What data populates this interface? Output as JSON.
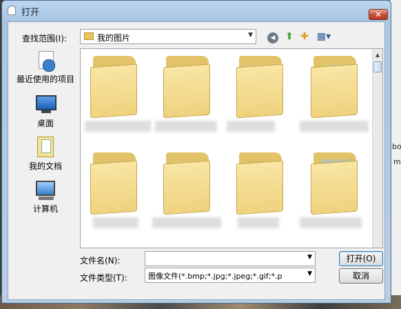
{
  "window": {
    "title": "打开",
    "close_label": "✕"
  },
  "toolbar": {
    "lookin_label": "查找范围(I):",
    "lookin_value": "我的图片",
    "combo_arrow": "▼",
    "back_glyph": "◀",
    "up_glyph": "⬆",
    "newfolder_glyph": "✚",
    "views_glyph": "▦▾"
  },
  "places": [
    {
      "label": "最近使用的项目",
      "icon": "recent-items-icon"
    },
    {
      "label": "桌面",
      "icon": "desktop-icon"
    },
    {
      "label": "我的文档",
      "icon": "my-documents-icon"
    },
    {
      "label": "计算机",
      "icon": "computer-icon"
    }
  ],
  "scroll": {
    "up_glyph": "▲"
  },
  "filename": {
    "label": "文件名(N):",
    "value": "",
    "arrow": "▼"
  },
  "filetype": {
    "label": "文件类型(T):",
    "value": "图像文件(*.bmp;*.jpg;*.jpeg;*.gif;*.p",
    "arrow": "▼"
  },
  "buttons": {
    "open": "打开(O)",
    "cancel": "取消"
  },
  "edge_text": [
    "bo",
    "m"
  ],
  "colors": {
    "title_bar": "#bcd6ee",
    "close_button": "#c8533d",
    "folder": "#efd27e"
  }
}
